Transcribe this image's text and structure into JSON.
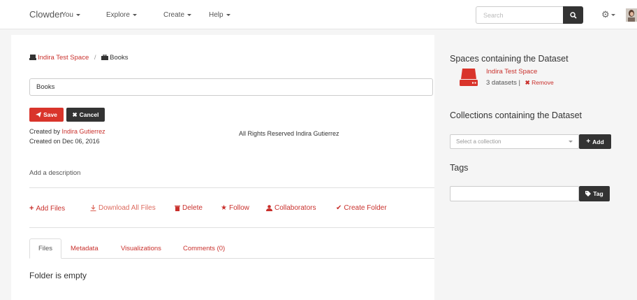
{
  "navbar": {
    "brand": "Clowder",
    "items": [
      {
        "label": "You"
      },
      {
        "label": "Explore"
      },
      {
        "label": "Create"
      },
      {
        "label": "Help"
      }
    ],
    "search_placeholder": "Search"
  },
  "breadcrumb": {
    "space": "Indira Test Space",
    "separator": "/",
    "current": "Books"
  },
  "form": {
    "name_value": "Books",
    "save_label": "Save",
    "cancel_label": "Cancel"
  },
  "meta": {
    "created_by_prefix": "Created by",
    "created_by_name": "Indira Gutierrez",
    "created_on": "Created on Dec 06, 2016",
    "rights": "All Rights Reserved Indira Gutierrez",
    "description_prompt": "Add a description"
  },
  "actions": [
    {
      "label": "Add Files",
      "icon": "plus-icon"
    },
    {
      "label": "Download All Files",
      "icon": "download-icon"
    },
    {
      "label": "Delete",
      "icon": "trash-icon"
    },
    {
      "label": "Follow",
      "icon": "star-icon"
    },
    {
      "label": "Collaborators",
      "icon": "user-icon"
    },
    {
      "label": "Create Folder",
      "icon": "check-icon"
    }
  ],
  "tabs": [
    {
      "label": "Files"
    },
    {
      "label": "Metadata"
    },
    {
      "label": "Visualizations"
    },
    {
      "label": "Comments (0)"
    }
  ],
  "files": {
    "empty_message": "Folder is empty"
  },
  "sidebar": {
    "spaces_heading": "Spaces containing the Dataset",
    "space_name": "Indira Test Space",
    "space_count": "3 datasets |",
    "remove_label": "Remove",
    "collections_heading": "Collections containing the Dataset",
    "collection_placeholder": "Select a collection",
    "add_label": "Add",
    "tags_heading": "Tags",
    "tag_label": "Tag"
  },
  "colors": {
    "accent": "#c9302c",
    "dark": "#333333"
  }
}
